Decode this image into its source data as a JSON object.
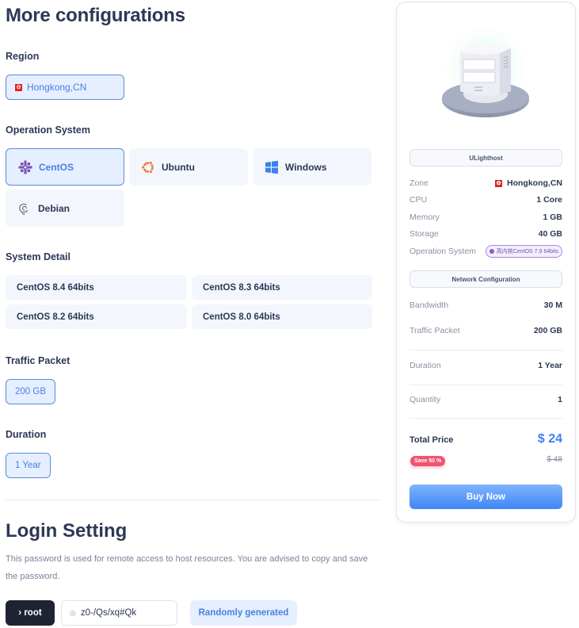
{
  "config": {
    "title": "More configurations",
    "region": {
      "label": "Region",
      "selected": "Hongkong,CN",
      "flag_glyph": "✿"
    },
    "os": {
      "label": "Operation System",
      "options": [
        {
          "name": "CentOS",
          "icon": "centos-icon",
          "selected": true
        },
        {
          "name": "Ubuntu",
          "icon": "ubuntu-icon",
          "selected": false
        },
        {
          "name": "Windows",
          "icon": "windows-icon",
          "selected": false
        },
        {
          "name": "Debian",
          "icon": "debian-icon",
          "selected": false
        }
      ]
    },
    "system_detail": {
      "label": "System Detail",
      "options": [
        "CentOS 8.4 64bits",
        "CentOS 8.3 64bits",
        "CentOS 8.2 64bits",
        "CentOS 8.0 64bits"
      ]
    },
    "traffic_packet": {
      "label": "Traffic Packet",
      "selected": "200 GB"
    },
    "duration": {
      "label": "Duration",
      "selected": "1 Year"
    }
  },
  "login": {
    "title": "Login Setting",
    "description": "This password is used for remote access to host resources. You are advised to copy and save the password.",
    "user_label": "› root",
    "password_value": "z0-/Qs/xq#Qk",
    "eye_glyph": "◎",
    "random_button": "Randomly generated"
  },
  "summary": {
    "product_name": "ULighthost",
    "specs": [
      {
        "key": "Zone",
        "value": "Hongkong,CN"
      },
      {
        "key": "CPU",
        "value": "1 Core"
      },
      {
        "key": "Memory",
        "value": "1 GB"
      },
      {
        "key": "Storage",
        "value": "40 GB"
      },
      {
        "key": "Operation System",
        "value": "高内核CentOS 7.9 64bits"
      }
    ],
    "network_heading": "Network Configuration",
    "network": [
      {
        "key": "Bandwidth",
        "value": "30 M"
      },
      {
        "key": "Traffic Packet",
        "value": "200 GB"
      }
    ],
    "duration": {
      "key": "Duration",
      "value": "1 Year"
    },
    "quantity": {
      "key": "Quantity",
      "value": "1"
    },
    "total_label": "Total Price",
    "total_value": "$ 24",
    "save_badge": "Save 50 %",
    "original_price": "$ 48",
    "buy_button": "Buy Now"
  },
  "colors": {
    "accent": "#4a80e0",
    "price": "#3b82f0",
    "save_badge": "#f1546e",
    "dark_button": "#1f2432"
  }
}
